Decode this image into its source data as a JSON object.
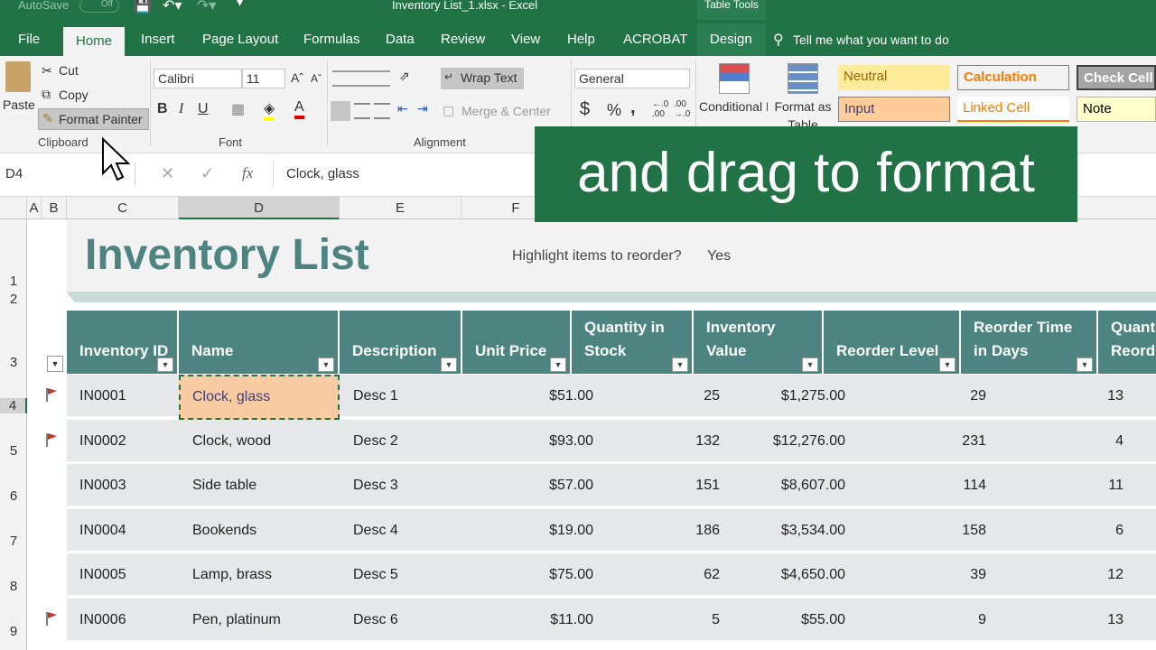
{
  "title_bar": {
    "autosave_label": "AutoSave",
    "autosave_state": "Off",
    "document_title": "Inventory List_1.xlsx  -  Excel",
    "context_label": "Table Tools"
  },
  "tabs": [
    "File",
    "Home",
    "Insert",
    "Page Layout",
    "Formulas",
    "Data",
    "Review",
    "View",
    "Help",
    "ACROBAT",
    "Design"
  ],
  "active_tab": "Home",
  "tell_me": "Tell me what you want to do",
  "ribbon": {
    "clipboard": {
      "paste": "Paste",
      "cut": "Cut",
      "copy": "Copy",
      "format_painter": "Format Painter",
      "group": "Clipboard"
    },
    "font": {
      "name": "Calibri",
      "size": "11",
      "group": "Font"
    },
    "alignment": {
      "wrap_text": "Wrap Text",
      "merge_center": "Merge & Center",
      "group": "Alignment"
    },
    "number": {
      "format": "General",
      "currency": "$",
      "percent": "%",
      "comma": ","
    },
    "styles": {
      "conditional": "Conditional Formatting",
      "format_as_table": "Format as Table",
      "items": [
        {
          "label": "Neutral",
          "bg": "#ffeb9c",
          "fg": "#9c6500"
        },
        {
          "label": "Calculation",
          "bg": "#f2f2f2",
          "fg": "#fa7d00"
        },
        {
          "label": "Check Cell",
          "bg": "#a5a5a5",
          "fg": "#ffffff"
        },
        {
          "label": "Input",
          "bg": "#ffcc99",
          "fg": "#3f3f76"
        },
        {
          "label": "Linked Cell",
          "bg": "#ffffff",
          "fg": "#fa7d00"
        },
        {
          "label": "Note",
          "bg": "#ffffcc",
          "fg": "#000000"
        }
      ]
    }
  },
  "formula_bar": {
    "name_box": "D4",
    "fx": "fx",
    "content": "Clock, glass"
  },
  "overlay_caption": "and drag to format",
  "columns": [
    "A",
    "B",
    "C",
    "D",
    "E",
    "F"
  ],
  "rows": [
    "1",
    "2",
    "3",
    "4",
    "5",
    "6",
    "7",
    "8",
    "9"
  ],
  "sheet": {
    "title": "Inventory List",
    "highlight_label": "Highlight items to reorder?",
    "highlight_value": "Yes",
    "headers": [
      "Inventory ID",
      "Name",
      "Description",
      "Unit Price",
      "Quantity in Stock",
      "Inventory Value",
      "Reorder Level",
      "Reorder Time in Days",
      "Quantity in Reorder"
    ],
    "header_lines": [
      [
        "Inventory ID"
      ],
      [
        "Name"
      ],
      [
        "Description"
      ],
      [
        "Unit Price"
      ],
      [
        "Quantity in",
        "Stock"
      ],
      [
        "Inventory",
        "Value"
      ],
      [
        "Reorder Level"
      ],
      [
        "Reorder Time",
        "in Days"
      ],
      [
        "Quant",
        "Reord"
      ]
    ],
    "data_rows": [
      {
        "id": "IN0001",
        "name": "Clock, glass",
        "desc": "Desc 1",
        "price": "$51.00",
        "qty": "25",
        "value": "$1,275.00",
        "reorder": "29",
        "days": "13",
        "flag": true
      },
      {
        "id": "IN0002",
        "name": "Clock, wood",
        "desc": "Desc 2",
        "price": "$93.00",
        "qty": "132",
        "value": "$12,276.00",
        "reorder": "231",
        "days": "4",
        "flag": true
      },
      {
        "id": "IN0003",
        "name": "Side table",
        "desc": "Desc 3",
        "price": "$57.00",
        "qty": "151",
        "value": "$8,607.00",
        "reorder": "114",
        "days": "11",
        "flag": false
      },
      {
        "id": "IN0004",
        "name": "Bookends",
        "desc": "Desc 4",
        "price": "$19.00",
        "qty": "186",
        "value": "$3,534.00",
        "reorder": "158",
        "days": "6",
        "flag": false
      },
      {
        "id": "IN0005",
        "name": "Lamp, brass",
        "desc": "Desc 5",
        "price": "$75.00",
        "qty": "62",
        "value": "$4,650.00",
        "reorder": "39",
        "days": "12",
        "flag": false
      },
      {
        "id": "IN0006",
        "name": "Pen, platinum",
        "desc": "Desc 6",
        "price": "$11.00",
        "qty": "5",
        "value": "$55.00",
        "reorder": "9",
        "days": "13",
        "flag": true
      }
    ]
  }
}
